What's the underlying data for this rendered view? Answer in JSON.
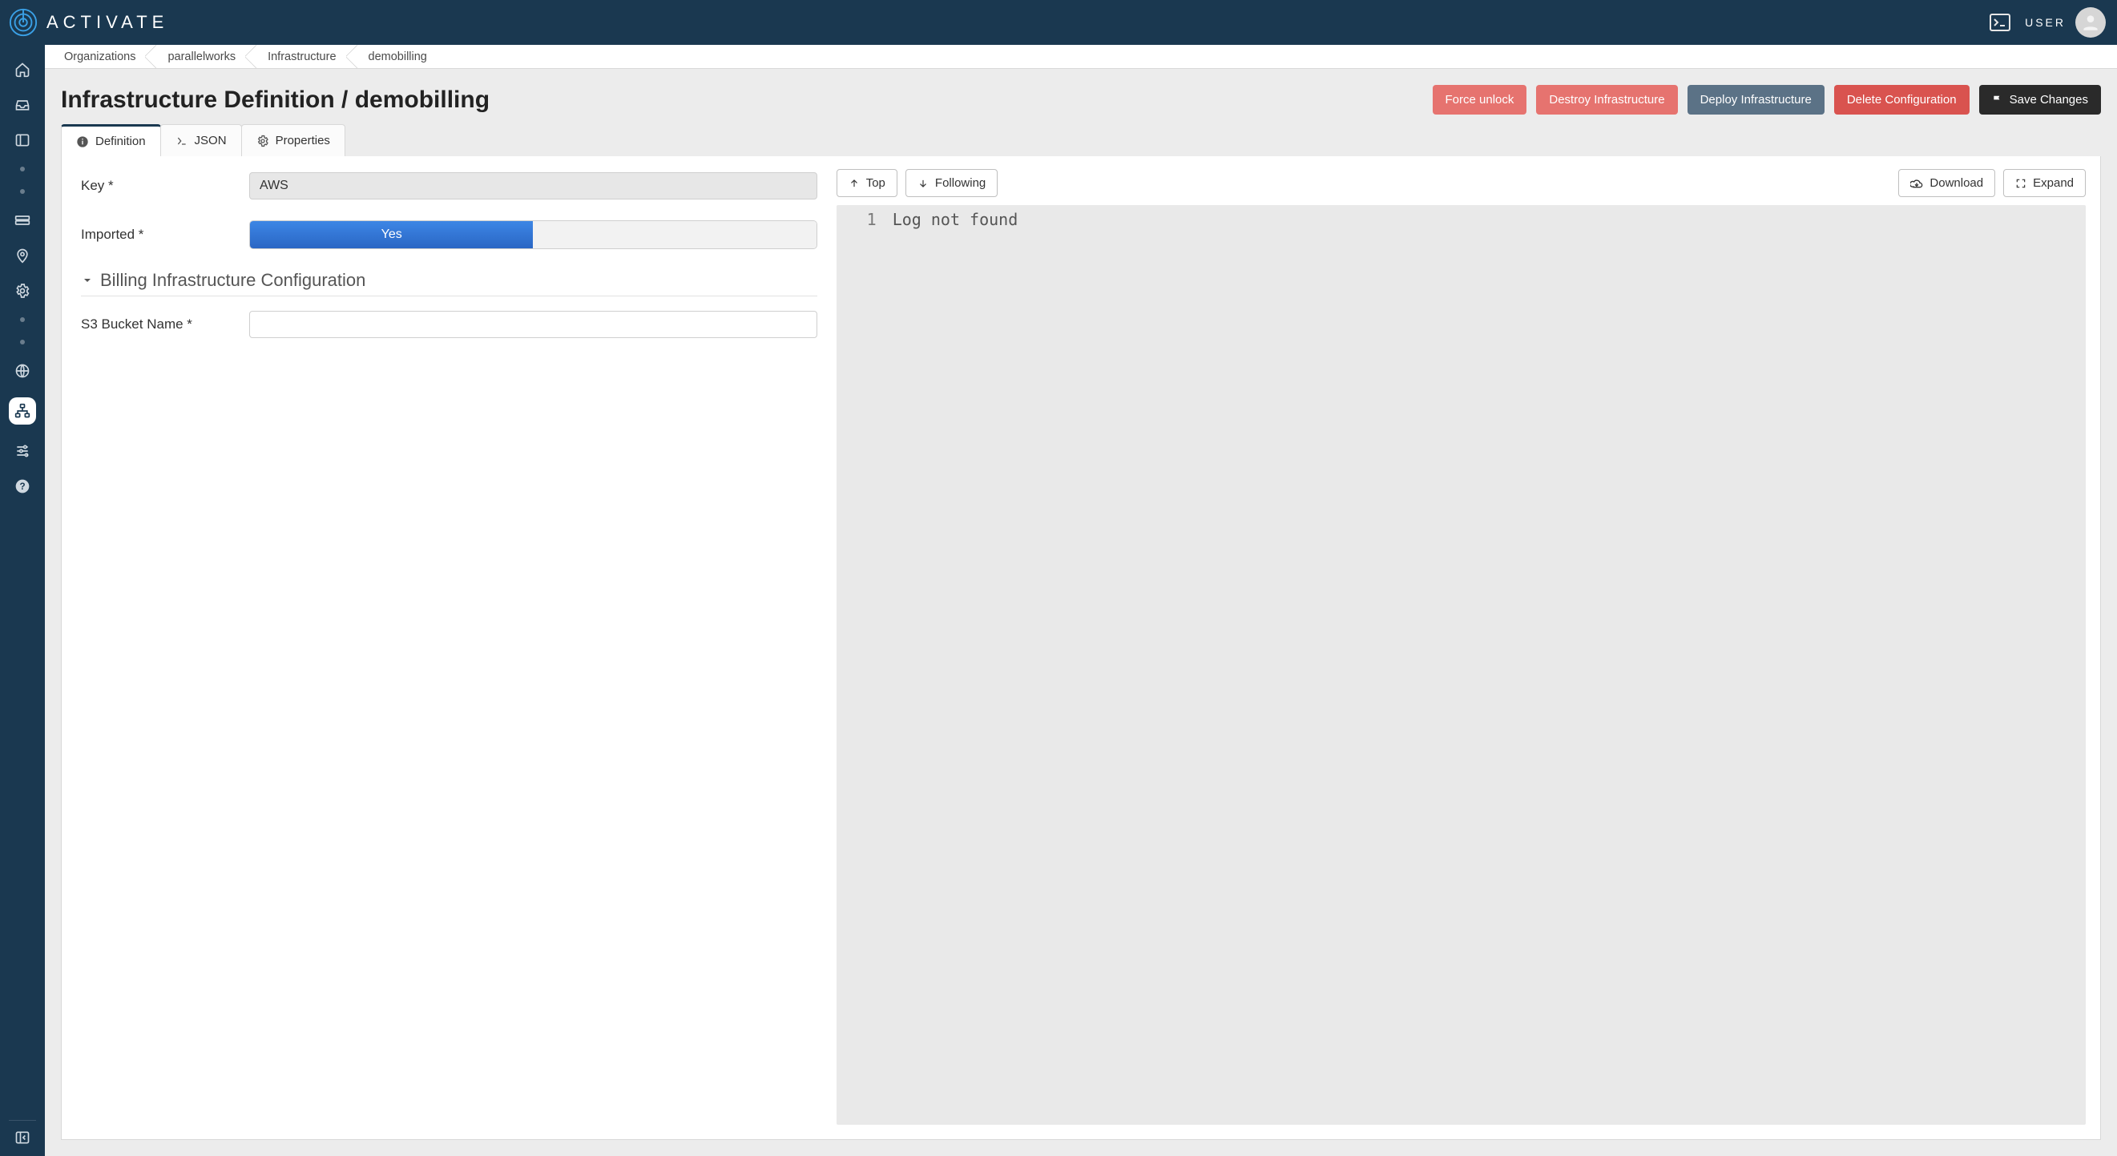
{
  "brand": {
    "name": "ACTIVATE"
  },
  "header": {
    "user_label": "USER"
  },
  "breadcrumbs": [
    "Organizations",
    "parallelworks",
    "Infrastructure",
    "demobilling"
  ],
  "page": {
    "title": "Infrastructure Definition / demobilling"
  },
  "actions": {
    "force_unlock": "Force unlock",
    "destroy": "Destroy Infrastructure",
    "deploy": "Deploy Infrastructure",
    "delete": "Delete Configuration",
    "save": "Save Changes"
  },
  "tabs": {
    "definition": "Definition",
    "json": "JSON",
    "properties": "Properties"
  },
  "form": {
    "key_label": "Key *",
    "key_value": "AWS",
    "imported_label": "Imported *",
    "imported_toggle": {
      "on": "Yes",
      "off": ""
    },
    "section_title": "Billing Infrastructure Configuration",
    "bucket_label": "S3 Bucket Name *",
    "bucket_value": ""
  },
  "log_toolbar": {
    "top": "Top",
    "following": "Following",
    "download": "Download",
    "expand": "Expand"
  },
  "log": {
    "lines": [
      {
        "n": "1",
        "text": "Log not found"
      }
    ]
  }
}
